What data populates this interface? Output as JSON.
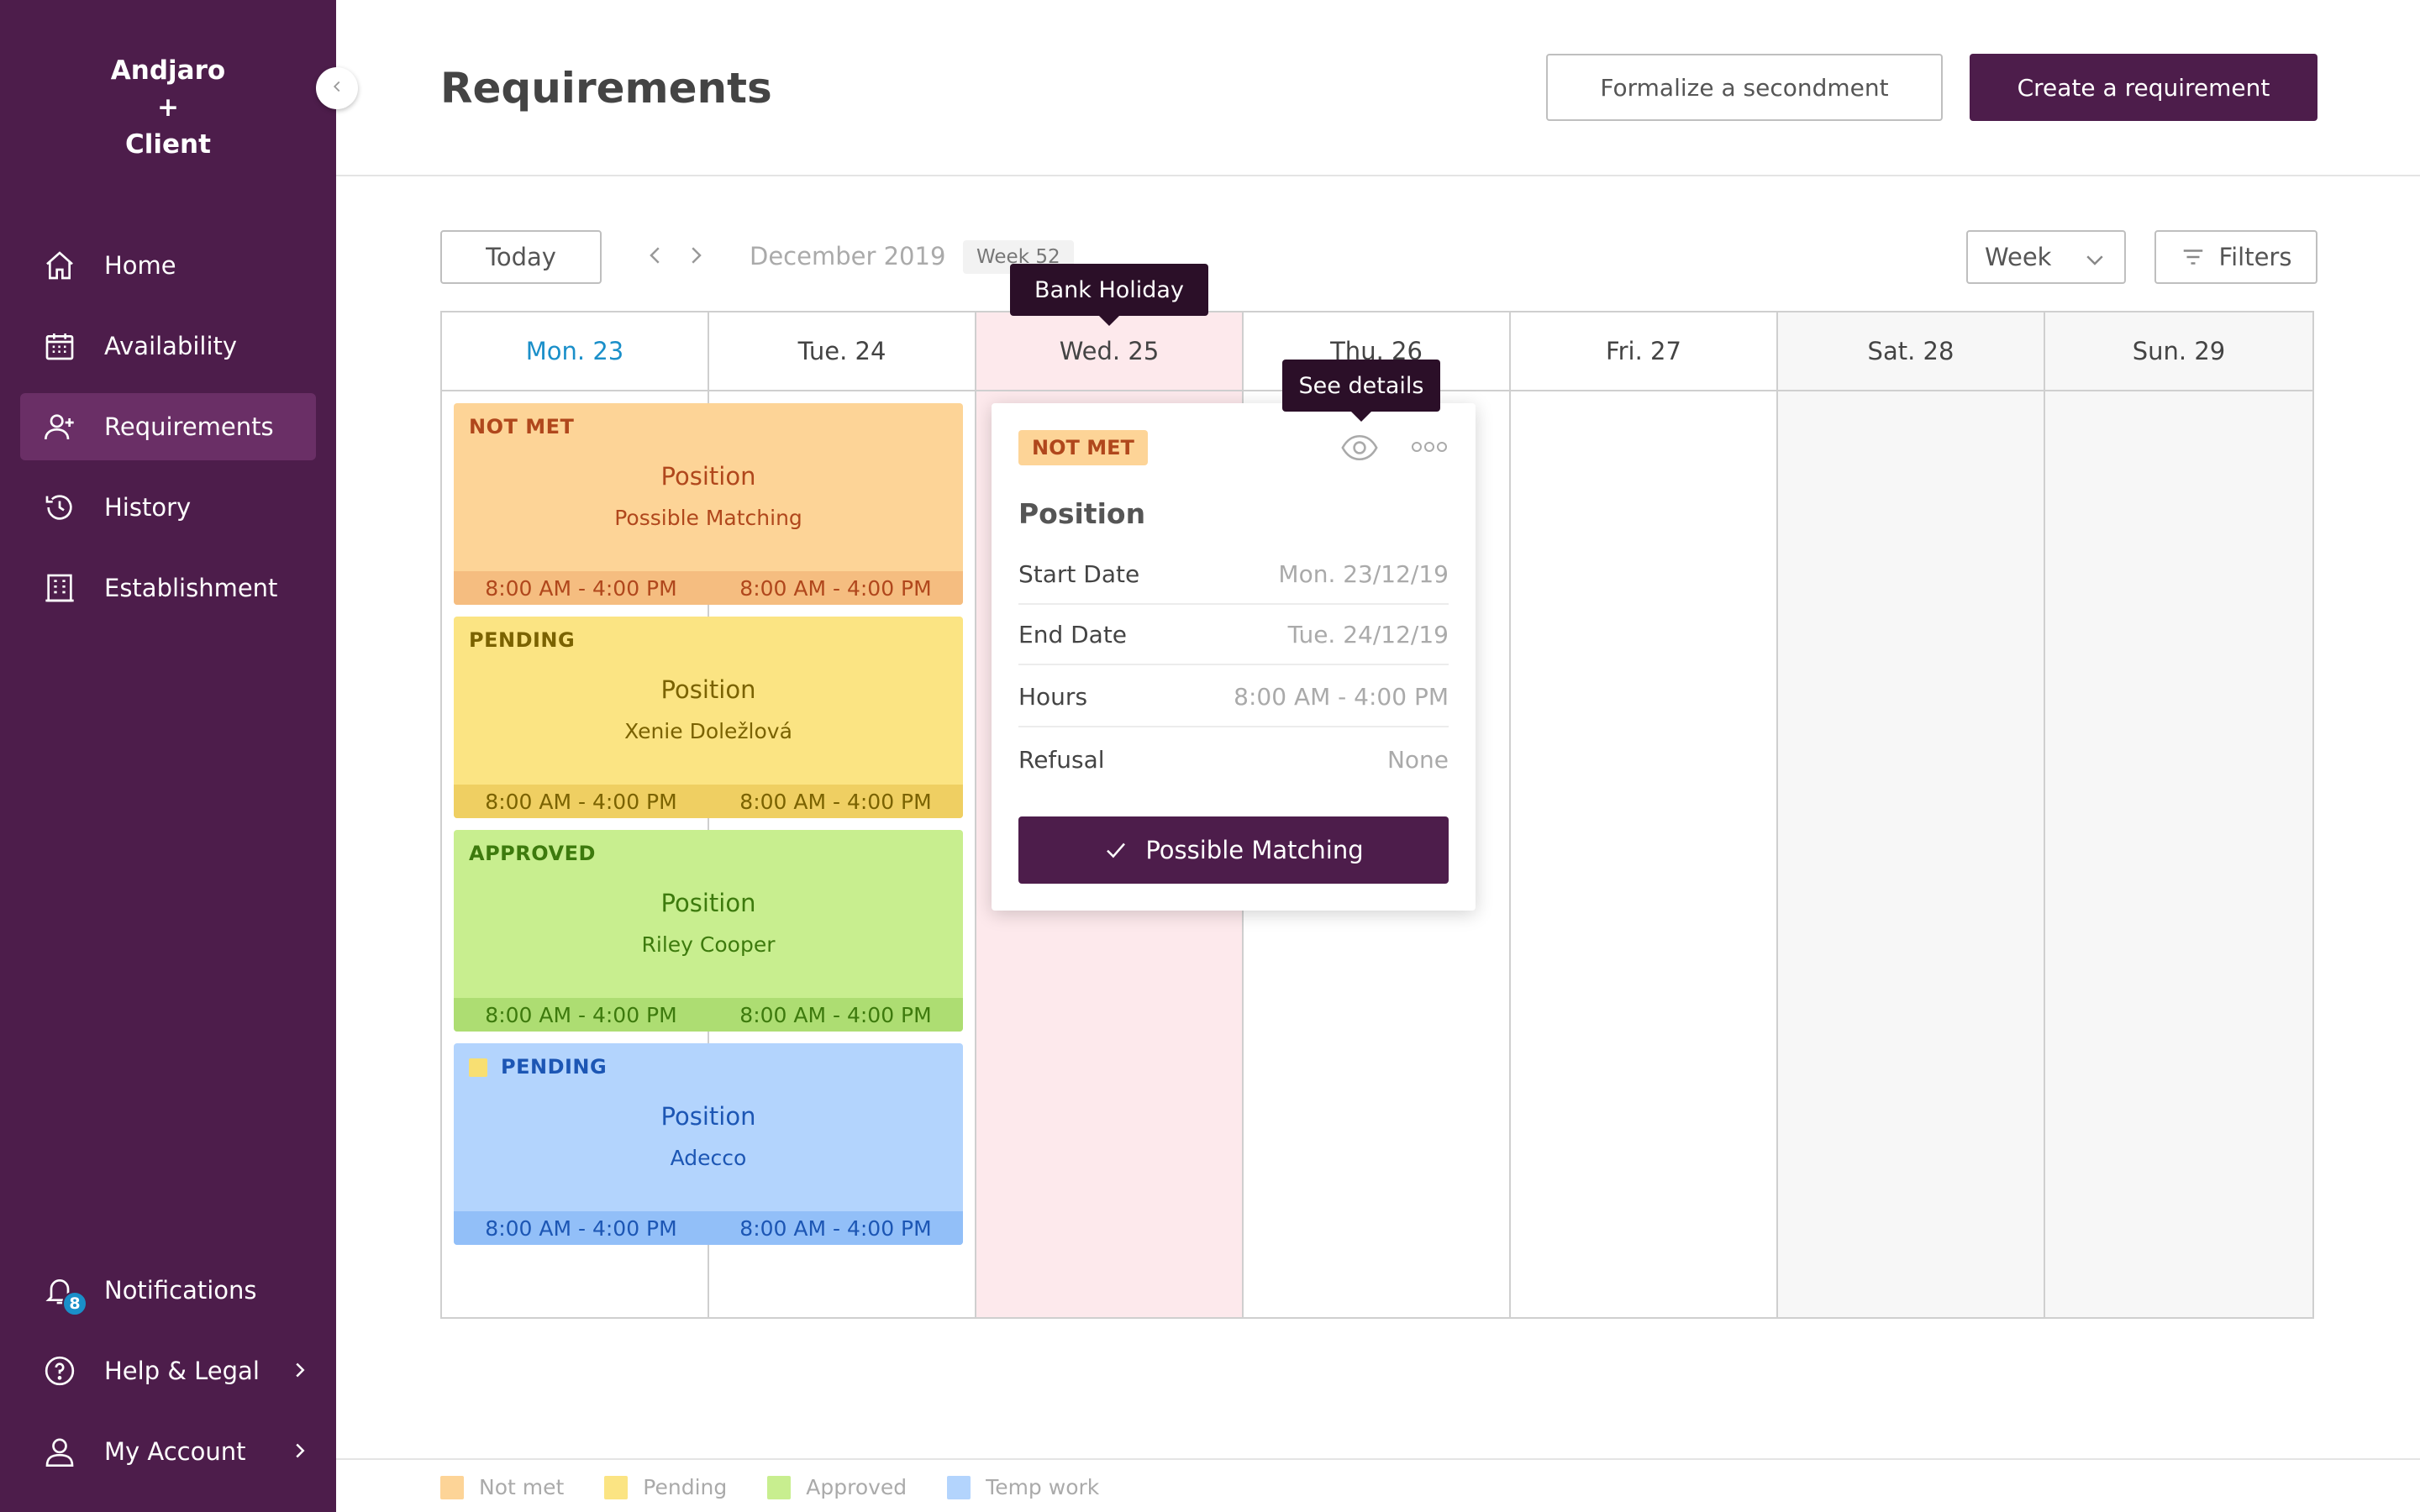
{
  "sidebar": {
    "brand": [
      "Andjaro",
      "+",
      "Client"
    ],
    "items": [
      {
        "label": "Home",
        "icon": "home-icon"
      },
      {
        "label": "Availability",
        "icon": "calendar-icon"
      },
      {
        "label": "Requirements",
        "icon": "user-plus-icon",
        "active": true
      },
      {
        "label": "History",
        "icon": "history-icon"
      },
      {
        "label": "Establishment",
        "icon": "building-icon"
      }
    ],
    "bottom_items": [
      {
        "label": "Notifications",
        "icon": "bell-icon",
        "badge": "8"
      },
      {
        "label": "Help & Legal",
        "icon": "help-icon"
      },
      {
        "label": "My Account",
        "icon": "user-icon"
      }
    ]
  },
  "header": {
    "title": "Requirements",
    "secondary_button": "Formalize a secondment",
    "primary_button": "Create a requirement"
  },
  "toolbar": {
    "today": "Today",
    "month": "December 2019",
    "week_chip": "Week 52",
    "view_select": "Week",
    "filters": "Filters"
  },
  "calendar": {
    "days": [
      "Mon. 23",
      "Tue. 24",
      "Wed. 25",
      "Thu. 26",
      "Fri. 27",
      "Sat. 28",
      "Sun. 29"
    ],
    "holiday_tooltip": "Bank Holiday",
    "cards": [
      {
        "status": "NOT MET",
        "title": "Position",
        "subtitle": "Possible Matching",
        "start_time": "8:00 AM - 4:00 PM",
        "end_time": "8:00 AM - 4:00 PM"
      },
      {
        "status": "PENDING",
        "title": "Position",
        "subtitle": "Xenie Doležlová",
        "start_time": "8:00 AM - 4:00 PM",
        "end_time": "8:00 AM - 4:00 PM"
      },
      {
        "status": "APPROVED",
        "title": "Position",
        "subtitle": "Riley Cooper",
        "start_time": "8:00 AM - 4:00 PM",
        "end_time": "8:00 AM - 4:00 PM"
      },
      {
        "status": "PENDING",
        "title": "Position",
        "subtitle": "Adecco",
        "start_time": "8:00 AM - 4:00 PM",
        "end_time": "8:00 AM - 4:00 PM"
      }
    ]
  },
  "popover": {
    "tooltip": "See details",
    "status": "NOT MET",
    "title": "Position",
    "rows": [
      {
        "label": "Start Date",
        "value": "Mon. 23/12/19"
      },
      {
        "label": "End Date",
        "value": "Tue. 24/12/19"
      },
      {
        "label": "Hours",
        "value": "8:00 AM - 4:00 PM"
      },
      {
        "label": "Refusal",
        "value": "None"
      }
    ],
    "button": "Possible Matching"
  },
  "legend": [
    {
      "label": "Not met",
      "color": "#fdd497"
    },
    {
      "label": "Pending",
      "color": "#fbe483"
    },
    {
      "label": "Approved",
      "color": "#c8ee8f"
    },
    {
      "label": "Temp work",
      "color": "#b3d4fd"
    }
  ],
  "colors": {
    "brand": "#4d1d4b",
    "today": "#1a8fc9",
    "holiday": "#fde9ec"
  }
}
